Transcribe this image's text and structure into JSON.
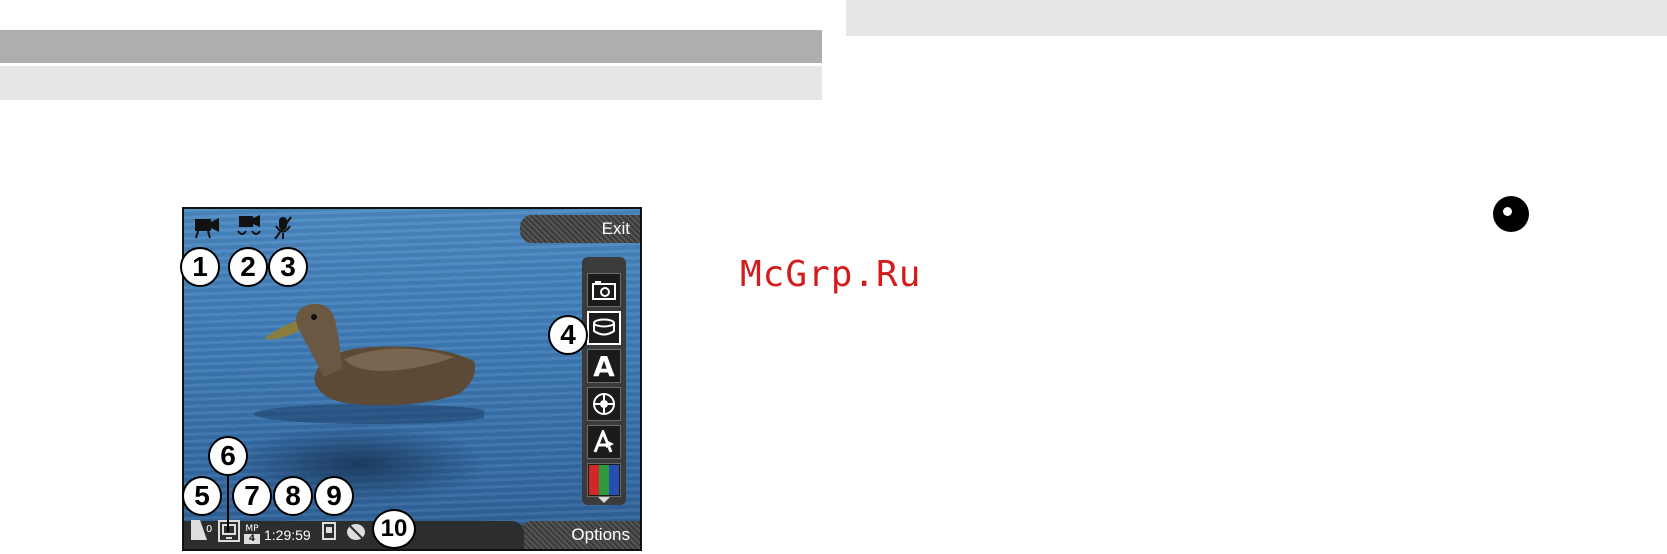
{
  "watermark": "McGrp.Ru",
  "viewfinder": {
    "softkeys": {
      "exit": "Exit",
      "options": "Options"
    },
    "timer": "1:29:59",
    "mem_count": "0",
    "format_badge": "MP",
    "format_badge_sub": "4",
    "toolbar_letter_a": "A"
  },
  "callouts": [
    "1",
    "2",
    "3",
    "4",
    "5",
    "6",
    "7",
    "8",
    "9",
    "10"
  ],
  "colors": {
    "watermark": "#d31c1c",
    "water": "#3f7bb6"
  }
}
